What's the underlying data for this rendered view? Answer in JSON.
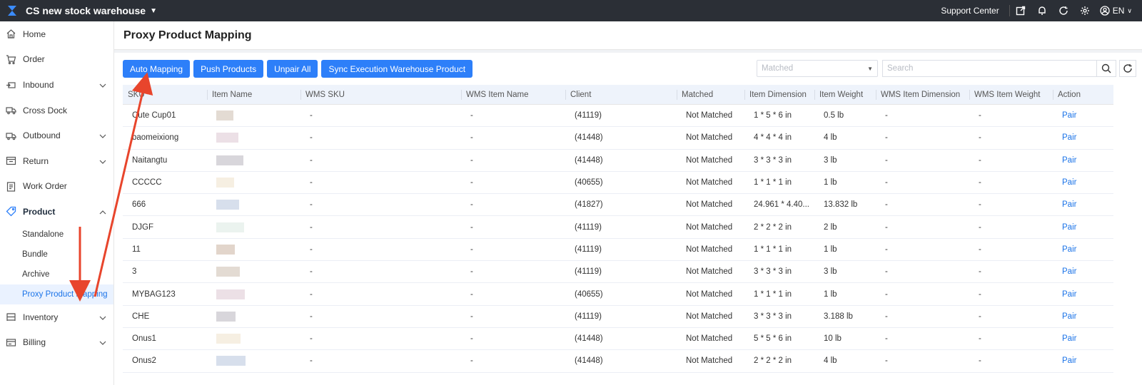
{
  "topbar": {
    "warehouse": "CS new stock warehouse",
    "support_center": "Support Center",
    "language": "EN",
    "icons": [
      "export-icon",
      "bell-icon",
      "refresh-icon",
      "gear-icon",
      "user-icon"
    ]
  },
  "sidebar": {
    "items": [
      {
        "label": "Home",
        "icon": "home-icon"
      },
      {
        "label": "Order",
        "icon": "cart-icon"
      },
      {
        "label": "Inbound",
        "icon": "inbound-icon"
      },
      {
        "label": "Cross Dock",
        "icon": "truck-icon"
      },
      {
        "label": "Outbound",
        "icon": "outbound-icon"
      },
      {
        "label": "Return",
        "icon": "return-icon"
      },
      {
        "label": "Work Order",
        "icon": "clipboard-icon"
      },
      {
        "label": "Product",
        "icon": "tag-icon"
      },
      {
        "label": "Inventory",
        "icon": "shelf-icon"
      },
      {
        "label": "Billing",
        "icon": "billing-icon"
      }
    ],
    "product_sub": [
      "Standalone",
      "Bundle",
      "Archive",
      "Proxy Product Mapping"
    ]
  },
  "page": {
    "title": "Proxy Product Mapping"
  },
  "toolbar": {
    "auto_mapping": "Auto Mapping",
    "push_products": "Push Products",
    "unpair_all": "Unpair All",
    "sync": "Sync Execution Warehouse Product"
  },
  "filters": {
    "matched_placeholder": "Matched",
    "search_placeholder": "Search"
  },
  "table": {
    "headers": [
      "SKU",
      "Item Name",
      "WMS SKU",
      "WMS Item Name",
      "Client",
      "Matched",
      "Item Dimension",
      "Item Weight",
      "WMS Item Dimension",
      "WMS Item Weight",
      "Action"
    ],
    "rows": [
      {
        "sku": "Cute Cup01",
        "wms_sku": "-",
        "wms_item_name": "-",
        "client": "(41119)",
        "matched": "Not Matched",
        "dimension": "1 * 5 * 6 in",
        "weight": "0.5 lb",
        "wms_dimension": "-",
        "wms_weight": "-",
        "action": "Pair"
      },
      {
        "sku": "baomeixiong",
        "wms_sku": "-",
        "wms_item_name": "-",
        "client": "(41448)",
        "matched": "Not Matched",
        "dimension": "4 * 4 * 4 in",
        "weight": "4 lb",
        "wms_dimension": "-",
        "wms_weight": "-",
        "action": "Pair"
      },
      {
        "sku": "Naitangtu",
        "wms_sku": "-",
        "wms_item_name": "-",
        "client": "(41448)",
        "matched": "Not Matched",
        "dimension": "3 * 3 * 3 in",
        "weight": "3 lb",
        "wms_dimension": "-",
        "wms_weight": "-",
        "action": "Pair"
      },
      {
        "sku": "CCCCC",
        "wms_sku": "-",
        "wms_item_name": "-",
        "client": "(40655)",
        "matched": "Not Matched",
        "dimension": "1 * 1 * 1 in",
        "weight": "1 lb",
        "wms_dimension": "-",
        "wms_weight": "-",
        "action": "Pair"
      },
      {
        "sku": "666",
        "wms_sku": "-",
        "wms_item_name": "-",
        "client": "(41827)",
        "matched": "Not Matched",
        "dimension": "24.961 * 4.40...",
        "weight": "13.832 lb",
        "wms_dimension": "-",
        "wms_weight": "-",
        "action": "Pair"
      },
      {
        "sku": "DJGF",
        "wms_sku": "-",
        "wms_item_name": "-",
        "client": "(41119)",
        "matched": "Not Matched",
        "dimension": "2 * 2 * 2 in",
        "weight": "2 lb",
        "wms_dimension": "-",
        "wms_weight": "-",
        "action": "Pair"
      },
      {
        "sku": "11",
        "wms_sku": "-",
        "wms_item_name": "-",
        "client": "(41119)",
        "matched": "Not Matched",
        "dimension": "1 * 1 * 1 in",
        "weight": "1 lb",
        "wms_dimension": "-",
        "wms_weight": "-",
        "action": "Pair"
      },
      {
        "sku": "3",
        "wms_sku": "-",
        "wms_item_name": "-",
        "client": "(41119)",
        "matched": "Not Matched",
        "dimension": "3 * 3 * 3 in",
        "weight": "3 lb",
        "wms_dimension": "-",
        "wms_weight": "-",
        "action": "Pair"
      },
      {
        "sku": "MYBAG123",
        "wms_sku": "-",
        "wms_item_name": "-",
        "client": "(40655)",
        "matched": "Not Matched",
        "dimension": "1 * 1 * 1 in",
        "weight": "1 lb",
        "wms_dimension": "-",
        "wms_weight": "-",
        "action": "Pair"
      },
      {
        "sku": "CHE",
        "wms_sku": "-",
        "wms_item_name": "-",
        "client": "(41119)",
        "matched": "Not Matched",
        "dimension": "3 * 3 * 3 in",
        "weight": "3.188 lb",
        "wms_dimension": "-",
        "wms_weight": "-",
        "action": "Pair"
      },
      {
        "sku": "Onus1",
        "wms_sku": "-",
        "wms_item_name": "-",
        "client": "(41448)",
        "matched": "Not Matched",
        "dimension": "5 * 5 * 6 in",
        "weight": "10 lb",
        "wms_dimension": "-",
        "wms_weight": "-",
        "action": "Pair"
      },
      {
        "sku": "Onus2",
        "wms_sku": "-",
        "wms_item_name": "-",
        "client": "(41448)",
        "matched": "Not Matched",
        "dimension": "2 * 2 * 2 in",
        "weight": "4 lb",
        "wms_dimension": "-",
        "wms_weight": "-",
        "action": "Pair"
      }
    ]
  },
  "colors": {
    "accent": "#2d7ff9",
    "link": "#1a73e8",
    "topbar": "#2b2f36",
    "annotation_arrow": "#e8452c"
  }
}
